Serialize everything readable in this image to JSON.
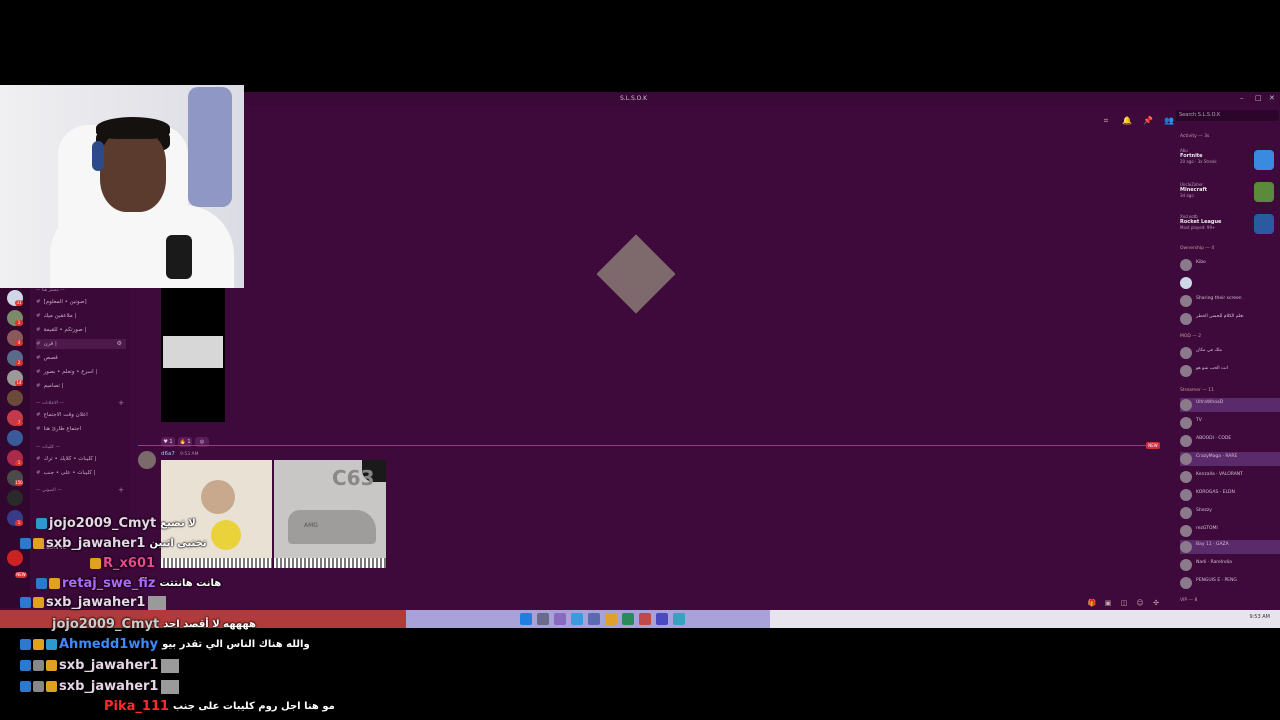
{
  "window": {
    "title": "S.L.S.O.K",
    "controls": [
      "–",
      "□",
      "✕"
    ],
    "search_placeholder": "Search S.L.S.O.K"
  },
  "server_rail": {
    "badges": [
      "31",
      "1",
      "4",
      "2",
      "14",
      "7",
      "1",
      "150",
      "1",
      "NEW"
    ]
  },
  "channels": {
    "categories": [
      "— مستر هنا —",
      "— الاعلانات —",
      "— كليبات —",
      "— الصوتي —"
    ],
    "items": [
      "[صوتين • المعلوم]",
      "ملاعقين ميك |",
      "صورتكم • للقيمة |",
      "قرن |",
      "قصص",
      "اسرع • وتعلم • بصور |",
      "تصاميم |",
      "اعلان وقت الاجتماع",
      "اجتماع طارئ هنا",
      "كليبات • كلايك • ترك |",
      "كليبات • على • جنب |"
    ],
    "voice_label": "THE BOYS VC"
  },
  "chat": {
    "author": "d6a7",
    "time": "9:53 AM",
    "new_badge": "NEW",
    "reactions": [
      "♥ 1",
      "🔥 1",
      "◎"
    ],
    "image2_text": "C63",
    "image2_brand": "AMG"
  },
  "members": {
    "activity_header": "Activity — 3s",
    "games": [
      {
        "user": "Abu",
        "name": "Fortnite",
        "detail": "20 ago · 3x Streak"
      },
      {
        "user": "UncleZaher",
        "name": "Minecraft",
        "detail": "3d ago"
      },
      {
        "user": "Xxd.xotb",
        "name": "Rocket League",
        "detail": "Most played: 99+"
      }
    ],
    "sections": [
      {
        "title": "Ownership — 4",
        "names": [
          "Kibo",
          "",
          "Sharing their screen",
          "تعلم الكلام للحسن الخطر"
        ]
      },
      {
        "title": "MOD — 2",
        "names": [
          "ملك في مكان",
          "انت الحب شو هو"
        ]
      },
      {
        "title": "Streamer — 11",
        "names": [
          "UltraWhoaD",
          "TV",
          "ABOODI · CODE",
          "CrazyMaga · RARE",
          "Kenzalla · VALORANT",
          "KOROGAS · ELDN",
          "Shezzy",
          "rezGTOMI",
          "Bay 11 · GAZA",
          "Nadi · RareIndia",
          "PENGUIS E · PENG"
        ]
      },
      {
        "title": "VIP — 8",
        "names": []
      }
    ]
  },
  "twitch_chat": [
    {
      "user": "jojo2009_Cmyt",
      "color": "#ffffff",
      "text": "لا تضيع",
      "thumb": false
    },
    {
      "user": "sxb_jawaher1",
      "color": "#ffffff",
      "text": "تختبى اثنين",
      "thumb": false
    },
    {
      "user": "R_x601",
      "color": "#e84a8a",
      "text": "",
      "thumb": false
    },
    {
      "user": "retaj_swe_fiz",
      "color": "#b069ff",
      "text": "هانت هانتتت",
      "thumb": false
    },
    {
      "user": "sxb_jawaher1",
      "color": "#ffffff",
      "text": "",
      "thumb": true
    },
    {
      "user": "jojo2009_Cmyt",
      "color": "#cccccc",
      "text": "ههههه لا أقصد احد",
      "thumb": false
    },
    {
      "user": "Ahmedd1why",
      "color": "#3b8bff",
      "text": "والله هناك الناس الي تقدر بيو",
      "thumb": false
    },
    {
      "user": "sxb_jawaher1",
      "color": "#ffffff",
      "text": "",
      "thumb": true
    },
    {
      "user": "sxb_jawaher1",
      "color": "#ffffff",
      "text": "",
      "thumb": true
    },
    {
      "user": "Pika_111",
      "color": "#ff2b2b",
      "text": "مو هنا اجل روم كليبات على جنب",
      "thumb": false
    }
  ],
  "taskbar": {
    "tray_time": "9:53 AM"
  },
  "colors": {
    "discord_bg": "#3d0a3b",
    "accent_new": "#c7313b"
  }
}
